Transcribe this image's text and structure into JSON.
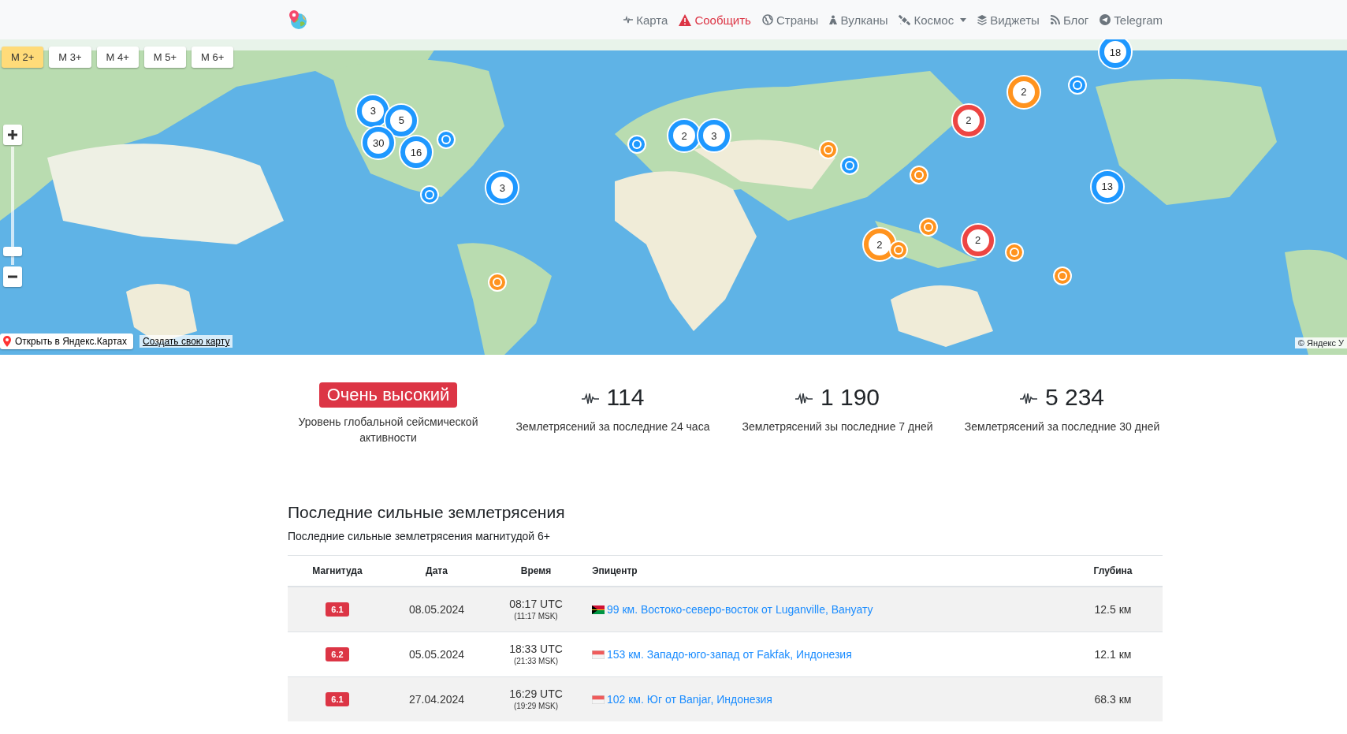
{
  "navbar": {
    "items": [
      {
        "label": "Карта",
        "kind": "pulse",
        "alert": false,
        "dropdown": false
      },
      {
        "label": "Сообщить",
        "kind": "warning",
        "alert": true,
        "dropdown": false
      },
      {
        "label": "Страны",
        "kind": "globe",
        "alert": false,
        "dropdown": false
      },
      {
        "label": "Вулканы",
        "kind": "volcano",
        "alert": false,
        "dropdown": false
      },
      {
        "label": "Космос",
        "kind": "satellite",
        "alert": false,
        "dropdown": true
      },
      {
        "label": "Виджеты",
        "kind": "layers",
        "alert": false,
        "dropdown": false
      },
      {
        "label": "Блог",
        "kind": "rss",
        "alert": false,
        "dropdown": false
      },
      {
        "label": "Telegram",
        "kind": "telegram",
        "alert": false,
        "dropdown": false
      }
    ]
  },
  "map": {
    "filters": [
      {
        "label": "M 2+",
        "selected": true
      },
      {
        "label": "M 3+",
        "selected": false
      },
      {
        "label": "M 4+",
        "selected": false
      },
      {
        "label": "M 5+",
        "selected": false
      },
      {
        "label": "M 6+",
        "selected": false
      }
    ],
    "zoom": {
      "level": 0.08
    },
    "markers": [
      {
        "kind": "cluster",
        "count": "3",
        "color": "#1e98ff"
      },
      {
        "kind": "cluster",
        "count": "5",
        "color": "#1e98ff"
      },
      {
        "kind": "cluster",
        "count": "30",
        "color": "#1e98ff"
      },
      {
        "kind": "cluster",
        "count": "16",
        "color": "#1e98ff"
      },
      {
        "kind": "point",
        "color": "#1e98ff"
      },
      {
        "kind": "point",
        "color": "#1e98ff"
      },
      {
        "kind": "cluster",
        "count": "3",
        "color": "#1e98ff"
      },
      {
        "kind": "point",
        "color": "#ff931e"
      },
      {
        "kind": "point",
        "color": "#1e98ff"
      },
      {
        "kind": "cluster",
        "count": "2",
        "color": "#1e98ff"
      },
      {
        "kind": "cluster",
        "count": "3",
        "color": "#1e98ff"
      },
      {
        "kind": "point",
        "color": "#ff931e"
      },
      {
        "kind": "point",
        "color": "#1e98ff"
      },
      {
        "kind": "point",
        "color": "#ff931e"
      },
      {
        "kind": "cluster",
        "count": "2",
        "color": "#ed4543"
      },
      {
        "kind": "cluster",
        "count": "2",
        "color": "#ff931e"
      },
      {
        "kind": "point",
        "color": "#1e98ff"
      },
      {
        "kind": "cluster",
        "count": "18",
        "color": "#1e98ff"
      },
      {
        "kind": "cluster",
        "count": "13",
        "color": "#1e98ff"
      },
      {
        "kind": "point",
        "color": "#ff931e"
      },
      {
        "kind": "cluster",
        "count": "2",
        "color": "#ff931e"
      },
      {
        "kind": "point",
        "color": "#ff931e"
      },
      {
        "kind": "cluster",
        "count": "2",
        "color": "#ed4543"
      },
      {
        "kind": "point",
        "color": "#ff931e"
      },
      {
        "kind": "point",
        "color": "#ff931e"
      }
    ],
    "open_link": "Открыть в Яндекс.Картах",
    "create_link": "Создать свою карту",
    "copyright": "© Яндекс У"
  },
  "stats": {
    "activity": {
      "badge": "Очень высокий",
      "caption": "Уровень глобальной сейсмической активности"
    },
    "counts": [
      {
        "value": "114",
        "caption": "Землетрясений за последние 24 часа"
      },
      {
        "value": "1 190",
        "caption": "Землетрясений зы последние 7 дней"
      },
      {
        "value": "5 234",
        "caption": "Землетрясений за последние 30 дней"
      }
    ]
  },
  "recent": {
    "title": "Последние сильные землетрясения",
    "subtitle": "Последние сильные землетрясения магнитудой 6+",
    "columns": [
      "Магнитуда",
      "Дата",
      "Время",
      "Эпицентр",
      "Глубина"
    ],
    "rows": [
      {
        "magnitude": "6.1",
        "date": "08.05.2024",
        "utc": "08:17 UTC",
        "msk": "(11:17 MSK)",
        "kind": "vanuatu",
        "epicenter": "99 км. Востоко-северо-восток от Luganville, Вануату",
        "depth": "12.5 км"
      },
      {
        "magnitude": "6.2",
        "date": "05.05.2024",
        "utc": "18:33 UTC",
        "msk": "(21:33 MSK)",
        "kind": "indonesia",
        "epicenter": "153 км. Западо-юго-запад от Fakfak, Индонезия",
        "depth": "12.1 км"
      },
      {
        "magnitude": "6.1",
        "date": "27.04.2024",
        "utc": "16:29 UTC",
        "msk": "(19:29 MSK)",
        "kind": "indonesia",
        "epicenter": "102 км. Юг от Banjar, Индонезия",
        "depth": "68.3 км"
      }
    ]
  }
}
